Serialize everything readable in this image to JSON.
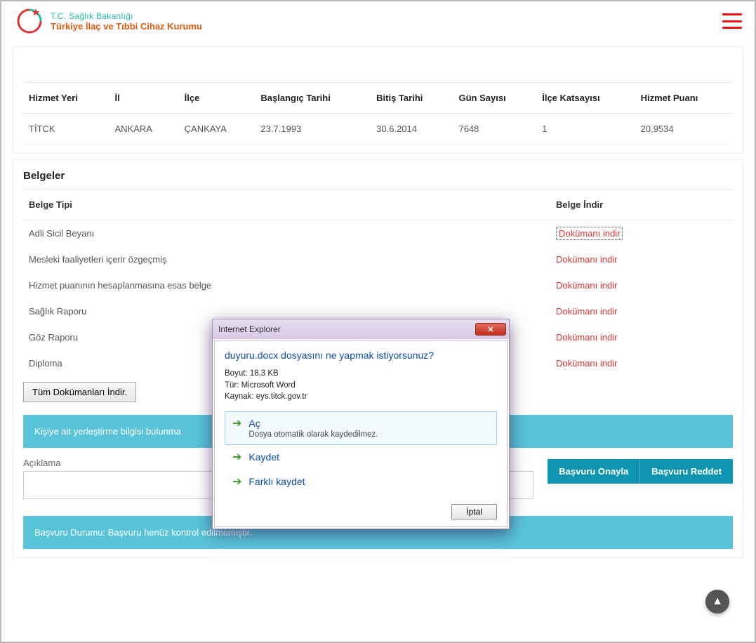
{
  "header": {
    "org_line1": "T.C. Sağlık Bakanlığı",
    "org_line2": "Türkiye İlaç ve Tıbbi Cihaz Kurumu"
  },
  "service_table": {
    "headers": [
      "Hizmet Yeri",
      "İl",
      "İlçe",
      "Başlangıç Tarihi",
      "Bitiş Tarihi",
      "Gün Sayısı",
      "İlçe Katsayısı",
      "Hizmet Puanı"
    ],
    "row": [
      "TİTCK",
      "ANKARA",
      "ÇANKAYA",
      "23.7.1993",
      "30.6.2014",
      "7648",
      "1",
      "20,9534"
    ]
  },
  "belgeler": {
    "title": "Belgeler",
    "col_type": "Belge Tipi",
    "col_download": "Belge İndir",
    "download_label": "Dokümanı indir",
    "items": [
      "Adli Sicil Beyanı",
      "Mesleki faaliyetleri içerir özgeçmiş",
      "Hizmet puanının hesaplanmasına esas belge",
      "Sağlık Raporu",
      "Göz Raporu",
      "Diploma"
    ],
    "download_all": "Tüm Dokümanları İndir."
  },
  "placement_info": "Kişiye ait yerleştirme bilgisi bulunma",
  "aciklama_label": "Açıklama",
  "actions": {
    "approve": "Başvuru Onayla",
    "reject": "Başvuru Reddet"
  },
  "status_bar": "Başvuru Durumu: Başvuru henüz kontrol edilmemiştir.",
  "ie_dialog": {
    "title": "Internet Explorer",
    "question": "duyuru.docx dosyasını ne yapmak istiyorsunuz?",
    "size_label": "Boyut:",
    "size_value": "18,3 KB",
    "type_label": "Tür:",
    "type_value": "Microsoft Word",
    "source_label": "Kaynak:",
    "source_value": "eys.titck.gov.tr",
    "open": "Aç",
    "open_sub": "Dosya otomatik olarak kaydedilmez.",
    "save": "Kaydet",
    "save_as": "Farklı kaydet",
    "cancel": "İptal"
  }
}
